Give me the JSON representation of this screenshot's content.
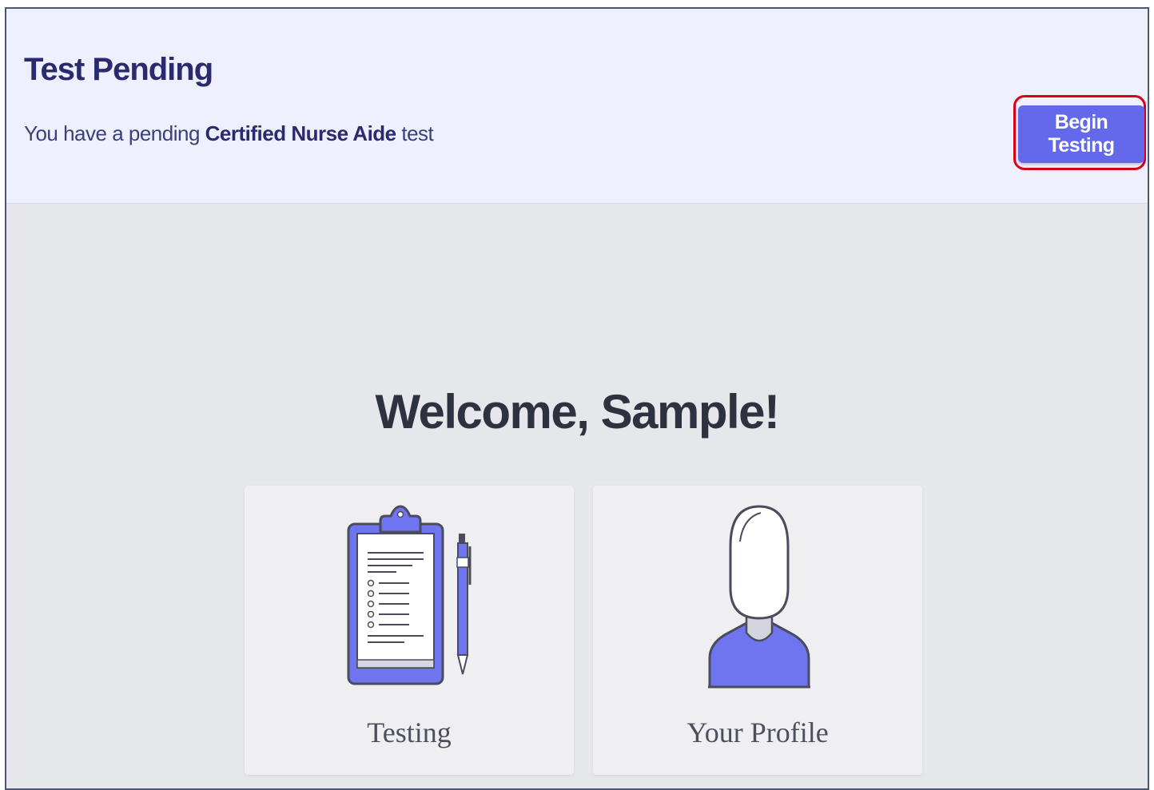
{
  "banner": {
    "title": "Test Pending",
    "message_prefix": "You have a pending ",
    "test_name": "Certified Nurse Aide",
    "message_suffix": " test",
    "button_label": "Begin Testing"
  },
  "welcome": {
    "heading": "Welcome, Sample!"
  },
  "cards": [
    {
      "label": "Testing",
      "icon": "clipboard-icon"
    },
    {
      "label": "Your Profile",
      "icon": "user-profile-icon"
    }
  ],
  "colors": {
    "banner_bg": "#eef1fd",
    "accent": "#6369ea",
    "title": "#2b2a6e",
    "highlight": "#d9001b",
    "page_bg": "#e6e7ea"
  }
}
